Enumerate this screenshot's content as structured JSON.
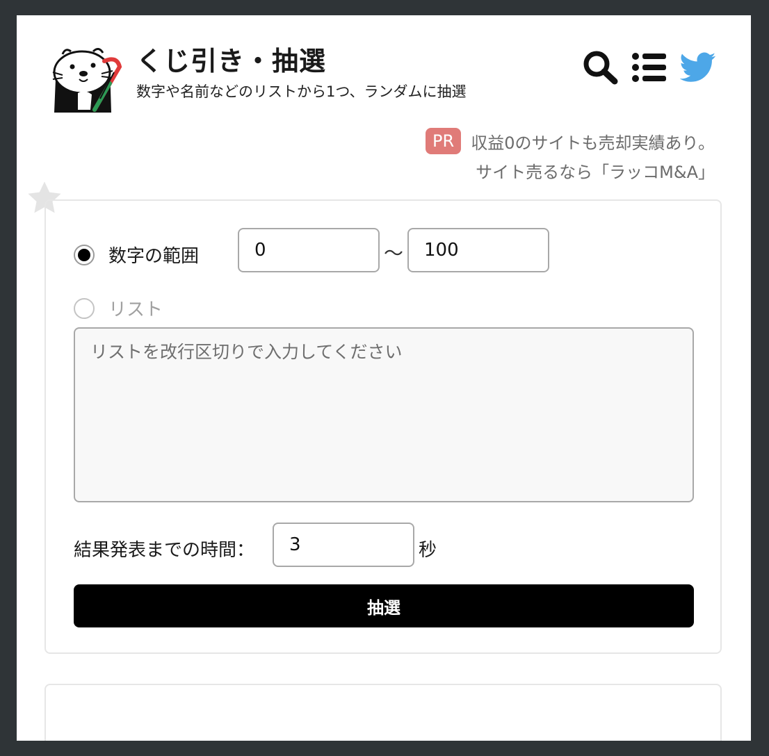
{
  "header": {
    "title": "くじ引き・抽選",
    "subtitle": "数字や名前などのリストから1つ、ランダムに抽選",
    "icons": [
      "otter-logo",
      "search-icon",
      "menu-list-icon",
      "twitter-icon"
    ]
  },
  "pr": {
    "badge": "PR",
    "line1": "収益0のサイトも売却実績あり。",
    "line2": "サイト売るなら「ラッコM&A」"
  },
  "form": {
    "mode_range_label": "数字の範囲",
    "range_min": "0",
    "range_separator": "～",
    "range_max": "100",
    "mode_list_label": "リスト",
    "list_placeholder": "リストを改行区切りで入力してください",
    "time_label": "結果発表までの時間：",
    "time_value": "3",
    "time_unit": "秒",
    "draw_button": "抽選"
  },
  "colors": {
    "frame": "#2f3437",
    "pr_badge": "#e07b78",
    "twitter": "#4da7e8",
    "button": "#000000"
  }
}
